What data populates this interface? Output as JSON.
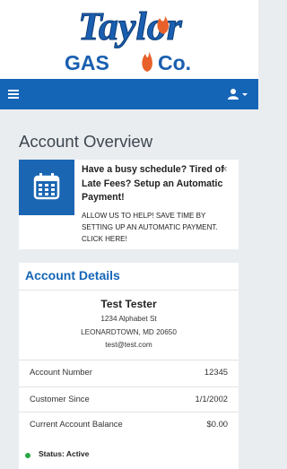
{
  "brand": {
    "name_top": "Taylor",
    "name_bottom_left": "GAS",
    "name_bottom_right": "Co."
  },
  "navbar": {
    "menu_icon": "hamburger-icon",
    "user_icon": "user-icon",
    "caret_icon": "caret-down-icon"
  },
  "page": {
    "title": "Account Overview"
  },
  "promo": {
    "icon": "calendar-icon",
    "close_label": "×",
    "headline": "Have a busy schedule? Tired of Late Fees? Setup an Automatic Payment!",
    "body": "Allow us to help! Save time by setting up an automatic payment. Click here!"
  },
  "account": {
    "title": "Account Details",
    "name": "Test Tester",
    "address_line1": "1234 Alphabet St",
    "address_line2": "LEONARDTOWN, MD 20650",
    "email": "test@test.com",
    "rows": [
      {
        "label": "Account Number",
        "value": "12345"
      },
      {
        "label": "Customer Since",
        "value": "1/1/2002"
      },
      {
        "label": "Current Account Balance",
        "value": "$0.00"
      }
    ],
    "status_label": "Status: Active"
  },
  "colors": {
    "brand_blue": "#1565b7",
    "status_green": "#2aa745"
  }
}
